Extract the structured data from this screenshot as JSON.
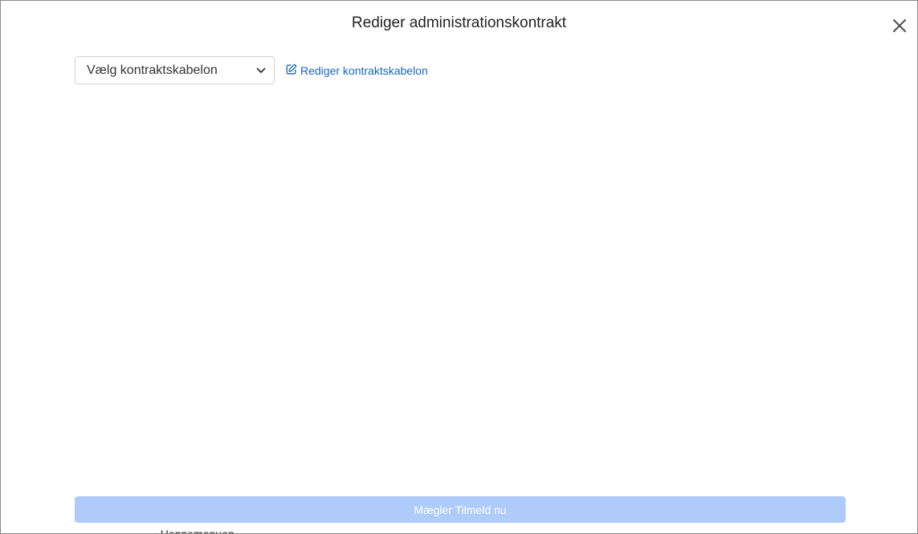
{
  "modal": {
    "title": "Rediger administrationskontrakt",
    "close_icon": "close-icon"
  },
  "template_select": {
    "selected": "Vælg kontraktskabelon",
    "chevron_icon": "chevron-down-icon"
  },
  "edit_template_link": {
    "icon": "edit-icon",
    "label": "Rediger kontraktskabelon",
    "color": "#1565c0"
  },
  "submit_button": {
    "label": "Mægler Tilmeld nu",
    "background": "#aecbfa"
  },
  "clipped_text": {
    "text": "• Hoppemenuen..."
  }
}
